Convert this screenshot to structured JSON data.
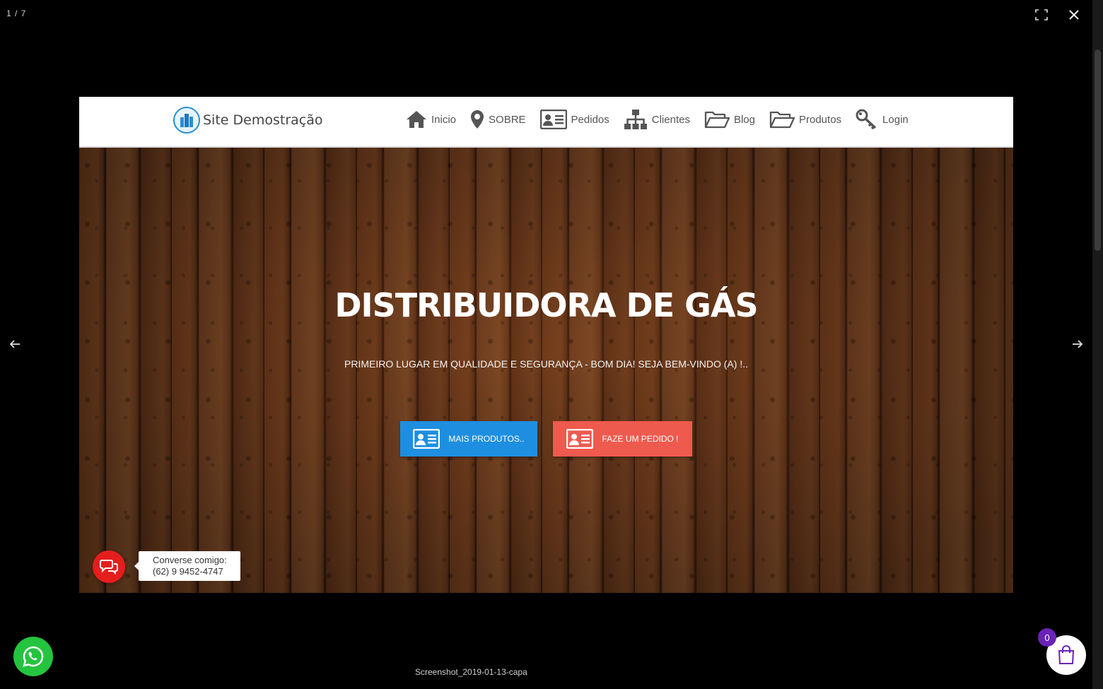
{
  "lightbox": {
    "counter": "1 / 7",
    "caption": "Screenshot_2019-01-13-capa",
    "fullscreen_icon": "fullscreen-icon",
    "close_icon": "close-icon",
    "prev_icon": "arrow-left-icon",
    "next_icon": "arrow-right-icon"
  },
  "site": {
    "brand": "Site Demostração",
    "menu": [
      {
        "label": "Inicio",
        "icon": "home-icon"
      },
      {
        "label": "SOBRE",
        "icon": "map-marker-icon"
      },
      {
        "label": "Pedidos",
        "icon": "id-card-icon"
      },
      {
        "label": "Clientes",
        "icon": "sitemap-icon"
      },
      {
        "label": "Blog",
        "icon": "folder-open-icon"
      },
      {
        "label": "Produtos",
        "icon": "folder-open-icon"
      },
      {
        "label": "Login",
        "icon": "key-icon"
      }
    ],
    "hero": {
      "title": "DISTRIBUIDORA DE GÁS",
      "subtitle": "PRIMEIRO LUGAR EM QUALIDADE E SEGURANÇA - BOM DIA! SEJA BEM-VINDO (A) !..",
      "button_primary": "MAIS PRODUTOS..",
      "button_secondary": "FAZE UM PEDIDO !"
    },
    "chat": {
      "line1": "Converse comigo:",
      "line2": "(62) 9 9452-4747"
    }
  },
  "cart": {
    "count": "0"
  },
  "colors": {
    "primary_button": "#1e8fe0",
    "secondary_button": "#ef5a4f",
    "chat_red": "#e61d1d",
    "whatsapp_green": "#25c43f",
    "cart_badge": "#6b23b6"
  }
}
